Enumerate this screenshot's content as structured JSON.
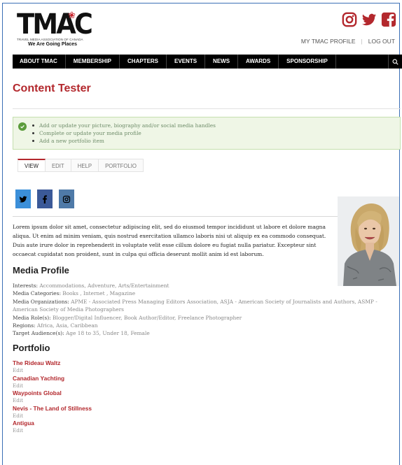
{
  "header": {
    "logo_text": "TMAC",
    "logo_subtitle": "TRAVEL MEDIA ASSOCIATION OF CANADA",
    "logo_tagline": "We Are Going Places",
    "top_links": [
      "MY TMAC PROFILE",
      "LOG OUT"
    ],
    "social_icons": [
      "instagram-icon",
      "twitter-icon",
      "facebook-icon"
    ],
    "brand_color": "#b3282d"
  },
  "nav": {
    "items": [
      "ABOUT TMAC",
      "MEMBERSHIP",
      "CHAPTERS",
      "EVENTS",
      "NEWS",
      "AWARDS",
      "SPONSORSHIP"
    ],
    "search_icon": "search-icon"
  },
  "page": {
    "title": "Content Tester"
  },
  "notice": {
    "items": [
      "Add or update your picture, biography and/or social media handles",
      "Complete or update your media profile",
      "Add a new portfolio item"
    ]
  },
  "tabs": [
    "VIEW",
    "EDIT",
    "HELP",
    "PORTFOLIO"
  ],
  "profile": {
    "social_buttons": [
      {
        "icon": "twitter-icon",
        "color": "#3b8fd9"
      },
      {
        "icon": "facebook-icon",
        "color": "#3b5998"
      },
      {
        "icon": "instagram-icon",
        "color": "#4f7aa8"
      }
    ],
    "bio": "Lorem ipsum dolor sit amet, consectetur adipiscing elit, sed do eiusmod tempor incididunt ut labore et dolore magna aliqua. Ut enim ad minim veniam, quis nostrud exercitation ullamco laboris nisi ut aliquip ex ea commodo consequat. Duis aute irure dolor in reprehenderit in voluptate velit esse cillum dolore eu fugiat nulla pariatur. Excepteur sint occaecat cupidatat non proident, sunt in culpa qui officia deserunt mollit anim id est laborum."
  },
  "media_profile": {
    "heading": "Media Profile",
    "fields": [
      {
        "label": "Interests:",
        "value": " Accommodations, Adventure, Arts/Entertainment"
      },
      {
        "label": "Media Categories:",
        "value": " Books , Internet , Magazine"
      },
      {
        "label": "Media Organizations:",
        "value": " APME - Associated Press Managing Editors Association, ASJA - American Society of Journalists and Authors, ASMP - American Society of Media Photographers"
      },
      {
        "label": "Media Role(s):",
        "value": " Blogger/Digital Influencer, Book Author/Editor, Freelance Photographer"
      },
      {
        "label": "Regions:",
        "value": " Africa, Asia, Caribbean"
      },
      {
        "label": "Target Audience(s):",
        "value": " Age 18 to 35, Under 18, Female"
      }
    ]
  },
  "portfolio": {
    "heading": "Portfolio",
    "edit_label": "Edit",
    "items": [
      "The Rideau Waltz",
      "Canadian Yachting",
      "Waypoints Global",
      "Nevis - The Land of Stillness",
      "Antigua"
    ]
  }
}
